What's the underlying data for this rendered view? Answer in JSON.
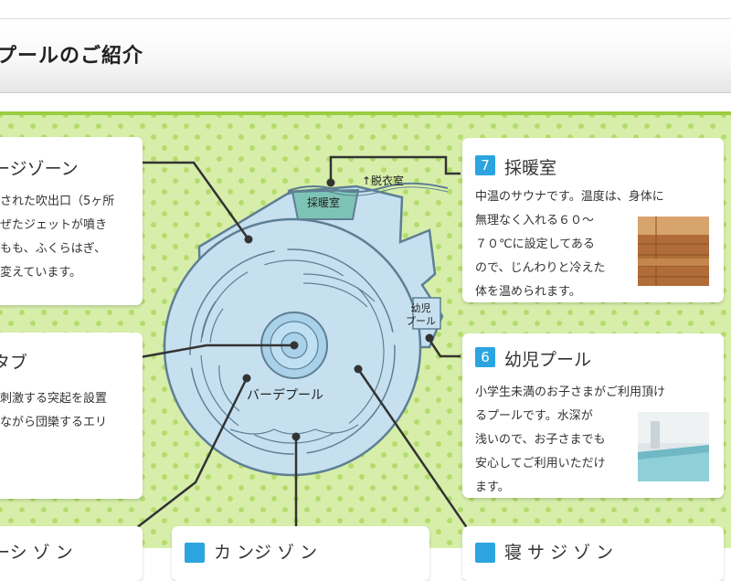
{
  "header": {
    "title": "プールのご紹介"
  },
  "map": {
    "label_sauna": "採暖室",
    "label_dressing": "↑脱衣室",
    "label_kids_pool": "幼児\nプール",
    "label_bade_pool": "バーデプール"
  },
  "cards": {
    "massage": {
      "title": "ージゾーン",
      "body": "された吹出口（5ヶ所\nぜたジェットが噴き\nもも、ふくらはぎ、\n変えています。"
    },
    "tub": {
      "title": "タブ",
      "body": "刺激する突起を設置\nながら団欒するエリ"
    },
    "sauna": {
      "number": "7",
      "title": "採暖室",
      "body": "中温のサウナです。温度は、身体に\n無理なく入れる６０～\n７０℃に設定してある\nので、じんわりと冷えた\n体を温められます。"
    },
    "kids": {
      "number": "6",
      "title": "幼児プール",
      "body": "小学生未満のお子さまがご利用頂け\nるプールです。水深が\n浅いので、お子さまでも\n安心してご利用いただけ\nます。"
    },
    "bottom_left": {
      "title": "ーシ ゾ  ン"
    },
    "bottom_mid": {
      "title": "カ    ンジ ゾ  ン"
    },
    "bottom_right": {
      "title": "寝  サ  ジ ゾ  ン"
    }
  },
  "colors": {
    "accent": "#2ba4e0",
    "green": "#9ccd3e",
    "pool": "#c6e0f0",
    "line": "#5e7f93"
  }
}
